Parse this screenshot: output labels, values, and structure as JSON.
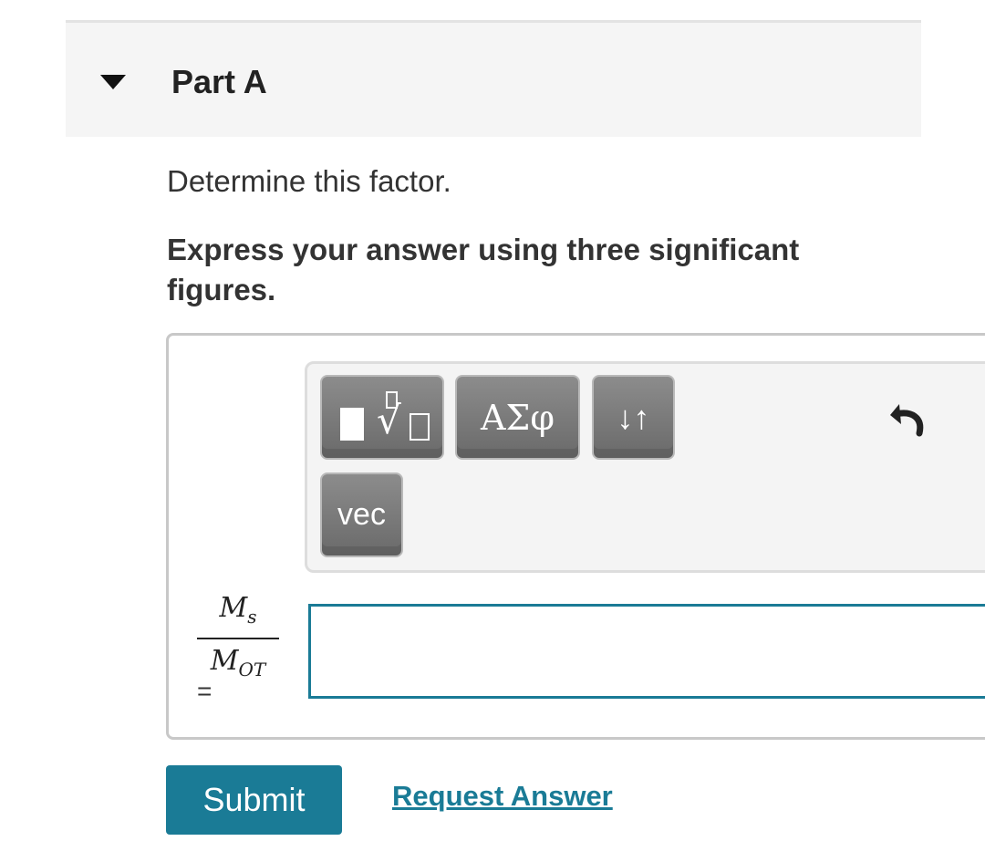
{
  "part": {
    "title": "Part A"
  },
  "question": {
    "text": "Determine this factor."
  },
  "instruction": {
    "text": "Express your answer using three significant figures."
  },
  "toolbar": {
    "templates_icon": "templates-radical-icon",
    "greek_label": "ΑΣφ",
    "arrows_label": "↓↑",
    "vec_label": "vec",
    "undo_icon": "undo-icon"
  },
  "formula": {
    "num_main": "M",
    "num_sub": "s",
    "den_main": "M",
    "den_sub": "OT",
    "equals": "="
  },
  "answer": {
    "value": "",
    "placeholder": ""
  },
  "actions": {
    "submit_label": "Submit",
    "request_label": "Request Answer"
  },
  "colors": {
    "accent": "#1a7b96",
    "header_bg": "#f5f5f5",
    "toolbar_button": "#7a7a7a"
  }
}
